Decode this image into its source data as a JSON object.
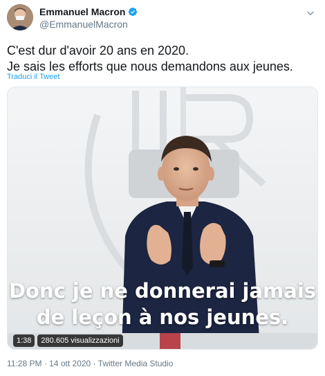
{
  "author": {
    "display_name": "Emmanuel Macron",
    "handle": "@EmmanuelMacron"
  },
  "tweet": {
    "line1": "C'est dur d'avoir 20 ans en 2020.",
    "line2": "Je sais les efforts que nous demandons aux jeunes.",
    "translate_label": "Traduci il Tweet"
  },
  "media": {
    "caption_line1": "Donc je ne donnerai jamais",
    "caption_line2": "de leçon à nos jeunes.",
    "duration": "1:38",
    "views": "280.605 visualizzazioni"
  },
  "meta": {
    "time": "11:28 PM",
    "separator": " · ",
    "date": "14 ott 2020",
    "source": "Twitter Media Studio"
  },
  "colors": {
    "accent": "#1da1f2",
    "muted": "#657786",
    "text": "#14171a"
  },
  "icons": [
    "verified-badge-icon",
    "chevron-down-icon"
  ]
}
